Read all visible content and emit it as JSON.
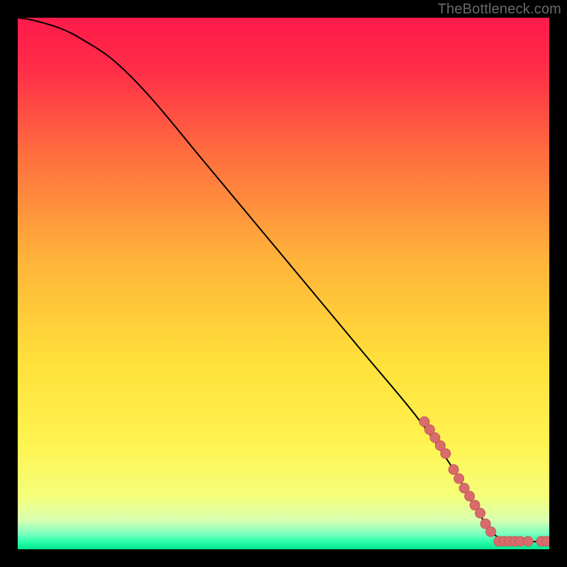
{
  "watermark": "TheBottleneck.com",
  "colors": {
    "curve": "#000000",
    "marker_fill": "#d86b6b",
    "marker_stroke": "#c55a5a",
    "frame_bg": "#000000"
  },
  "chart_data": {
    "type": "line",
    "title": "",
    "xlabel": "",
    "ylabel": "",
    "xlim": [
      0,
      100
    ],
    "ylim": [
      0,
      100
    ],
    "grid": false,
    "background_gradient_stops": [
      {
        "offset": 0.0,
        "color": "#ff1a4b"
      },
      {
        "offset": 0.1,
        "color": "#ff2e48"
      },
      {
        "offset": 0.25,
        "color": "#ff6b3f"
      },
      {
        "offset": 0.45,
        "color": "#ffb23a"
      },
      {
        "offset": 0.65,
        "color": "#ffe13a"
      },
      {
        "offset": 0.8,
        "color": "#fff350"
      },
      {
        "offset": 0.9,
        "color": "#f5ff7a"
      },
      {
        "offset": 0.945,
        "color": "#d8ffb0"
      },
      {
        "offset": 0.97,
        "color": "#7fffc0"
      },
      {
        "offset": 0.985,
        "color": "#2fffad"
      },
      {
        "offset": 1.0,
        "color": "#00e58f"
      }
    ],
    "series": [
      {
        "name": "curve",
        "x": [
          0,
          3,
          8,
          12,
          18,
          25,
          35,
          45,
          55,
          65,
          75,
          82,
          86,
          90,
          95,
          100
        ],
        "y": [
          100,
          99.5,
          98,
          96,
          92,
          85,
          73,
          61,
          49,
          37,
          25,
          15,
          8,
          2.5,
          1.5,
          1.5
        ]
      }
    ],
    "markers": {
      "name": "highlighted-points",
      "points": [
        {
          "x": 76.5,
          "y": 24.0
        },
        {
          "x": 77.5,
          "y": 22.5
        },
        {
          "x": 78.5,
          "y": 21.0
        },
        {
          "x": 79.5,
          "y": 19.5
        },
        {
          "x": 80.5,
          "y": 18.0
        },
        {
          "x": 82.0,
          "y": 15.0
        },
        {
          "x": 83.0,
          "y": 13.3
        },
        {
          "x": 84.0,
          "y": 11.5
        },
        {
          "x": 85.0,
          "y": 10.0
        },
        {
          "x": 86.0,
          "y": 8.3
        },
        {
          "x": 87.0,
          "y": 6.8
        },
        {
          "x": 88.0,
          "y": 4.8
        },
        {
          "x": 89.0,
          "y": 3.3
        },
        {
          "x": 90.5,
          "y": 1.5
        },
        {
          "x": 91.5,
          "y": 1.5
        },
        {
          "x": 92.5,
          "y": 1.5
        },
        {
          "x": 93.5,
          "y": 1.5
        },
        {
          "x": 94.5,
          "y": 1.5
        },
        {
          "x": 96.0,
          "y": 1.5
        },
        {
          "x": 98.5,
          "y": 1.5
        },
        {
          "x": 99.5,
          "y": 1.5
        }
      ]
    }
  }
}
